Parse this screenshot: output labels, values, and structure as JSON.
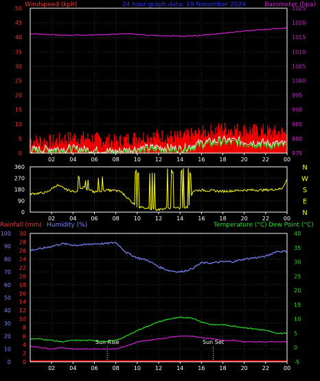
{
  "header": {
    "left_title": "Windspeed (kph)",
    "center_title": "24 hour graph data: 19 November 2024",
    "right_title": "Barometer (hpa)"
  },
  "colors": {
    "background": "#000000",
    "grid": "#2e2e2e",
    "axis_red": "#ff3030",
    "title_blue": "#3030ff",
    "magenta": "#d020d0",
    "yellow": "#ffff00",
    "green": "#20e020",
    "lightblue": "#7c86ff",
    "white": "#ffffff",
    "gust_red": "#ff0000"
  },
  "chart_data": [
    {
      "type": "line",
      "name": "wind-barometer",
      "x_ticks": [
        "02",
        "04",
        "06",
        "08",
        "10",
        "12",
        "14",
        "16",
        "18",
        "20",
        "22",
        "00"
      ],
      "left_axis": {
        "label": "Windspeed (kph)",
        "ticks": [
          50,
          45,
          40,
          35,
          30,
          25,
          20,
          15,
          10,
          5,
          0
        ],
        "ylim": [
          0,
          50
        ]
      },
      "right_axis": {
        "label": "Barometer (hpa)",
        "ticks": [
          1025,
          1020,
          1015,
          1010,
          1005,
          1000,
          995,
          990,
          985,
          980,
          975
        ],
        "ylim": [
          975,
          1025
        ]
      },
      "series": [
        {
          "name": "Barometer",
          "axis": "right",
          "x": [
            0,
            3,
            6,
            9,
            12,
            15,
            17,
            19,
            21,
            23,
            24
          ],
          "y": [
            1016.2,
            1015.7,
            1015.8,
            1016.2,
            1015.5,
            1015.4,
            1016.0,
            1016.8,
            1017.4,
            1018.0,
            1018.2
          ]
        },
        {
          "name": "Wind gust",
          "axis": "left",
          "x": [
            0,
            2,
            4,
            6,
            8,
            10,
            12,
            14,
            16,
            18,
            20,
            22,
            24
          ],
          "y": [
            4.5,
            4.0,
            5.5,
            5.0,
            4.0,
            5.5,
            6.0,
            5.5,
            7.0,
            8.5,
            8.0,
            7.5,
            7.0
          ]
        },
        {
          "name": "Windspeed",
          "axis": "left",
          "x": [
            0,
            2,
            4,
            6,
            8,
            10,
            12,
            14,
            16,
            18,
            20,
            22,
            24
          ],
          "y": [
            1.0,
            1.5,
            1.5,
            1.0,
            0.5,
            1.5,
            2.0,
            1.5,
            3.5,
            4.5,
            4.0,
            3.5,
            3.0
          ]
        }
      ]
    },
    {
      "type": "line",
      "name": "wind-direction",
      "x_ticks": [
        "02",
        "04",
        "06",
        "08",
        "10",
        "12",
        "14",
        "16",
        "18",
        "20",
        "22",
        "00"
      ],
      "left_axis": {
        "ticks": [
          360,
          270,
          180,
          90,
          0
        ],
        "ylim": [
          0,
          360
        ]
      },
      "right_axis": {
        "ticks": [
          "N",
          "W",
          "S",
          "E",
          "N"
        ]
      },
      "series": [
        {
          "name": "Wind direction",
          "x": [
            0,
            1.5,
            2.5,
            3.5,
            4.2,
            5,
            6,
            7,
            8,
            8.5,
            10,
            11,
            12,
            13,
            14,
            14.8,
            15.2,
            16,
            18,
            20,
            22,
            23.5,
            24
          ],
          "y": [
            145,
            155,
            215,
            175,
            165,
            195,
            160,
            175,
            170,
            160,
            40,
            30,
            20,
            35,
            30,
            40,
            170,
            175,
            165,
            175,
            175,
            185,
            260
          ]
        }
      ]
    },
    {
      "type": "line",
      "name": "rain-humidity-temperature",
      "left_labels": {
        "rainfall": "Rainfall (mm)",
        "humidity": "Humidity (%)"
      },
      "right_labels": {
        "temperature": "Temperature (°C)",
        "dewpoint": "Dew Point (°C)"
      },
      "x_ticks": [
        "02",
        "04",
        "06",
        "08",
        "10",
        "12",
        "14",
        "16",
        "18",
        "20",
        "22",
        "00"
      ],
      "humidity_axis": {
        "ticks": [
          100,
          90,
          80,
          70,
          60,
          50,
          40,
          30,
          20,
          10,
          0
        ],
        "ylim": [
          0,
          100
        ]
      },
      "rainfall_axis": {
        "ticks": [
          30,
          28,
          26,
          24,
          22,
          20,
          18,
          16,
          14,
          12,
          10,
          8,
          6,
          4,
          2,
          0
        ],
        "ylim": [
          0,
          30
        ]
      },
      "temperature_axis": {
        "ticks": [
          40,
          35,
          30,
          25,
          20,
          15,
          10,
          5,
          0,
          -5
        ],
        "ylim": [
          -5,
          40
        ]
      },
      "annotations": [
        {
          "label": "Sun Rise",
          "x": 7.2
        },
        {
          "label": "Sun Set",
          "x": 17.1
        }
      ],
      "series": [
        {
          "name": "Humidity",
          "axis": "humidity",
          "x": [
            0,
            1,
            2,
            3,
            4,
            5,
            6,
            7,
            8,
            9,
            10,
            11,
            12,
            13,
            14,
            15,
            16,
            17,
            18,
            19,
            20,
            21,
            22,
            23,
            24
          ],
          "y": [
            87,
            88,
            90,
            92,
            91,
            91,
            92,
            92,
            93,
            85,
            81,
            79,
            74,
            71,
            70,
            72,
            77,
            77,
            78,
            78,
            80,
            81,
            82,
            86,
            86
          ]
        },
        {
          "name": "Temperature",
          "axis": "temperature",
          "x": [
            0,
            1,
            2,
            3,
            4,
            5,
            6,
            7,
            8,
            9,
            10,
            11,
            12,
            13,
            14,
            15,
            16,
            17,
            18,
            19,
            20,
            21,
            22,
            23,
            24
          ],
          "y": [
            3,
            3,
            2.5,
            2,
            2.5,
            2.5,
            2.5,
            2,
            2.5,
            4,
            6,
            7.5,
            9,
            10,
            10.5,
            10.5,
            9,
            8,
            8,
            7.5,
            7,
            6.5,
            6,
            5,
            5
          ]
        },
        {
          "name": "Dew Point",
          "axis": "temperature",
          "x": [
            0,
            1,
            2,
            3,
            4,
            5,
            6,
            7,
            8,
            9,
            10,
            11,
            12,
            13,
            14,
            15,
            16,
            17,
            18,
            19,
            20,
            21,
            22,
            23,
            24
          ],
          "y": [
            0.5,
            0,
            -0.5,
            0,
            -0.5,
            -0.5,
            -0.5,
            -0.5,
            -0.5,
            0.5,
            2,
            2.5,
            3,
            3.5,
            4,
            4,
            3.5,
            3,
            2.5,
            2.5,
            2,
            2,
            2,
            2,
            2
          ]
        },
        {
          "name": "Rainfall",
          "axis": "rainfall",
          "x": [
            0,
            24
          ],
          "y": [
            0,
            0
          ]
        }
      ]
    }
  ]
}
